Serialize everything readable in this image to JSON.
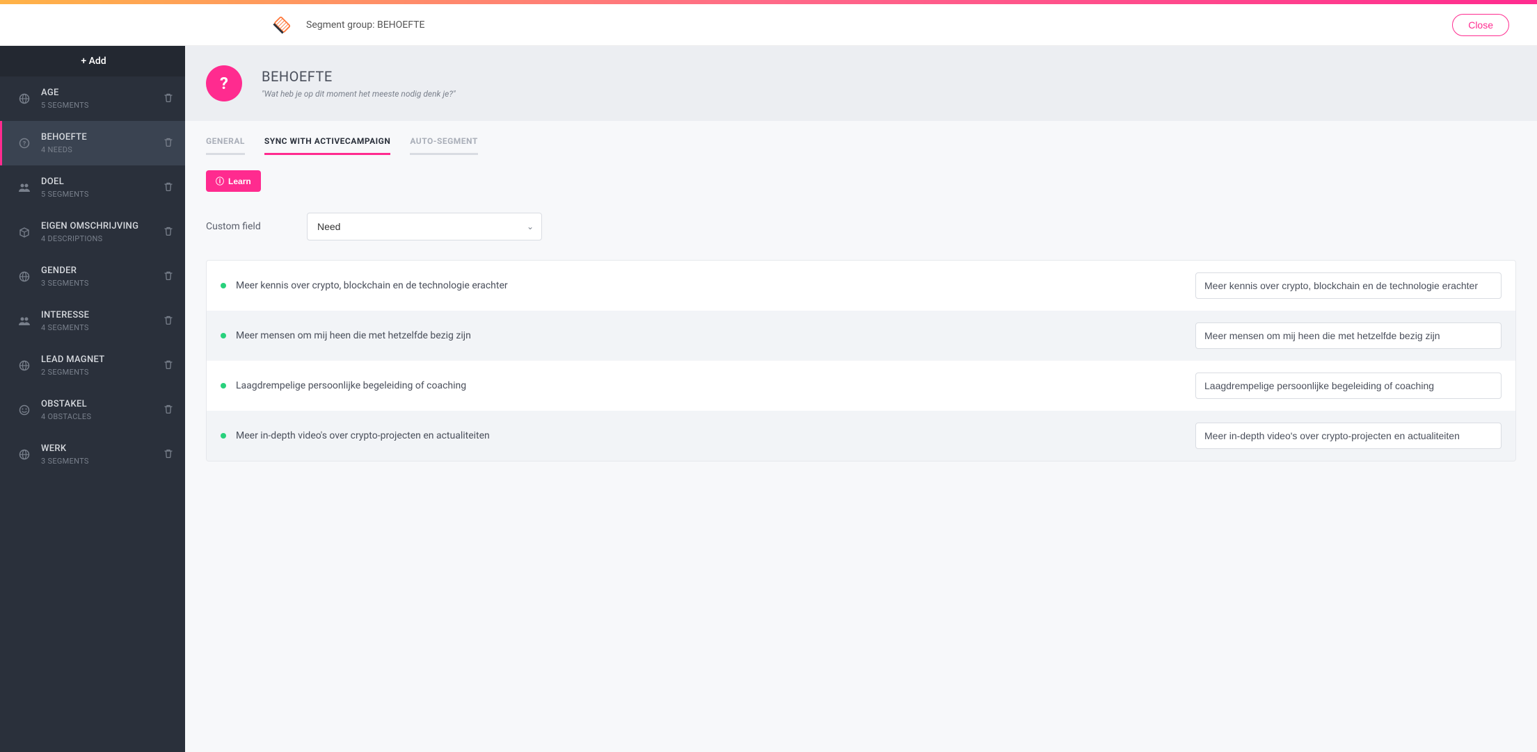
{
  "header": {
    "title": "Segment group: BEHOEFTE",
    "close_label": "Close"
  },
  "sidebar": {
    "add_label": "+ Add",
    "items": [
      {
        "icon": "globe",
        "title": "AGE",
        "sub": "5 SEGMENTS"
      },
      {
        "icon": "question",
        "title": "BEHOEFTE",
        "sub": "4 NEEDS"
      },
      {
        "icon": "users",
        "title": "DOEL",
        "sub": "5 SEGMENTS"
      },
      {
        "icon": "box",
        "title": "EIGEN OMSCHRIJVING",
        "sub": "4 DESCRIPTIONS"
      },
      {
        "icon": "globe",
        "title": "GENDER",
        "sub": "3 SEGMENTS"
      },
      {
        "icon": "users",
        "title": "INTERESSE",
        "sub": "4 SEGMENTS"
      },
      {
        "icon": "globe",
        "title": "LEAD MAGNET",
        "sub": "2 SEGMENTS"
      },
      {
        "icon": "smile",
        "title": "OBSTAKEL",
        "sub": "4 OBSTACLES"
      },
      {
        "icon": "globe",
        "title": "WERK",
        "sub": "3 SEGMENTS"
      }
    ],
    "active_index": 1
  },
  "page": {
    "icon_glyph": "?",
    "title": "BEHOEFTE",
    "subtitle": "\"Wat heb je op dit moment het meeste nodig denk je?\""
  },
  "tabs": {
    "items": [
      {
        "label": "GENERAL"
      },
      {
        "label": "SYNC WITH ACTIVECAMPAIGN"
      },
      {
        "label": "AUTO-SEGMENT"
      }
    ],
    "active_index": 1
  },
  "learn_label": "Learn",
  "custom_field": {
    "label": "Custom field",
    "value": "Need"
  },
  "rows": [
    {
      "label": "Meer kennis over crypto, blockchain en de technologie erachter",
      "value": "Meer kennis over crypto, blockchain en de technologie erachter"
    },
    {
      "label": "Meer mensen om mij heen die met hetzelfde bezig zijn",
      "value": "Meer mensen om mij heen die met hetzelfde bezig zijn"
    },
    {
      "label": "Laagdrempelige persoonlijke begeleiding of coaching",
      "value": "Laagdrempelige persoonlijke begeleiding of coaching"
    },
    {
      "label": "Meer in-depth video's over crypto-projecten en actualiteiten",
      "value": "Meer in-depth video's over crypto-projecten en actualiteiten"
    }
  ]
}
